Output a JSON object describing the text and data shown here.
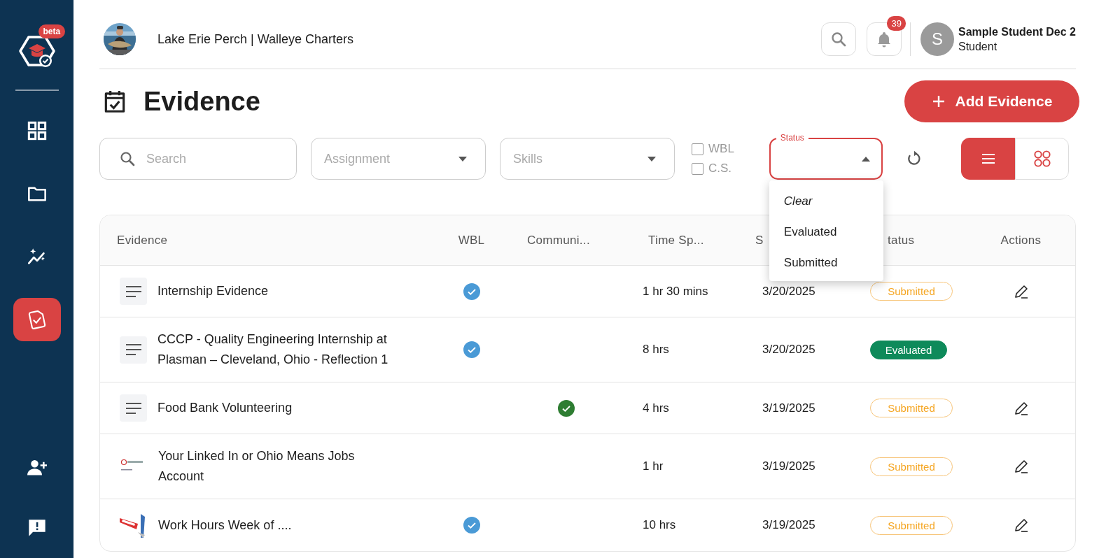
{
  "sidebar": {
    "badge": "beta",
    "items": [
      {
        "kind": "grid",
        "selected": false
      },
      {
        "kind": "folder",
        "selected": false
      },
      {
        "kind": "chart",
        "selected": false
      },
      {
        "kind": "evidence",
        "selected": true
      }
    ],
    "bottom_items": [
      {
        "kind": "add-user",
        "selected": false
      },
      {
        "kind": "feedback",
        "selected": false
      }
    ]
  },
  "header": {
    "organization": "Lake Erie Perch | Walleye Charters",
    "notifications": "39",
    "user": {
      "initial": "S",
      "name": "Sample Student Dec 2",
      "role": "Student"
    }
  },
  "page": {
    "title": "Evidence",
    "add_button": "Add Evidence"
  },
  "filters": {
    "search": {
      "placeholder": "Search"
    },
    "assignment": {
      "placeholder": "Assignment"
    },
    "skills": {
      "placeholder": "Skills"
    },
    "checkboxes": [
      {
        "label": "WBL",
        "checked": false
      },
      {
        "label": "C.S.",
        "checked": false
      }
    ],
    "status": {
      "label": "Status",
      "expanded": true,
      "options": [
        {
          "label": "Clear",
          "kind": "clear"
        },
        {
          "label": "Evaluated",
          "kind": "option"
        },
        {
          "label": "Submitted",
          "kind": "option"
        }
      ]
    },
    "views": [
      {
        "kind": "list",
        "selected": true
      },
      {
        "kind": "grid",
        "selected": false
      }
    ]
  },
  "table": {
    "columns": [
      "Evidence",
      "WBL",
      "Communi...",
      "Time Sp...",
      "S",
      "tatus",
      "Actions"
    ],
    "rows": [
      {
        "kind": "document",
        "title": "Internship Evidence",
        "wbl": true,
        "community": false,
        "time": "1 hr 30 mins",
        "date": "3/20/2025",
        "status": {
          "label": "Submitted",
          "kind": "submitted"
        },
        "editable": true
      },
      {
        "kind": "document",
        "title": "CCCP - Quality Engineering Internship at Plasman – Cleveland, Ohio - Reflection 1",
        "wbl": true,
        "community": false,
        "time": "8 hrs",
        "date": "3/20/2025",
        "status": {
          "label": "Evaluated",
          "kind": "evaluated"
        },
        "editable": false
      },
      {
        "kind": "document",
        "title": "Food Bank Volunteering",
        "wbl": false,
        "community": true,
        "time": "4 hrs",
        "date": "3/19/2025",
        "status": {
          "label": "Submitted",
          "kind": "submitted"
        },
        "editable": true
      },
      {
        "kind": "picture",
        "title": "Your Linked In or Ohio Means Jobs Account",
        "wbl": false,
        "community": false,
        "time": "1 hr",
        "date": "3/19/2025",
        "status": {
          "label": "Submitted",
          "kind": "submitted"
        },
        "editable": true
      },
      {
        "kind": "picture",
        "title": "Work Hours Week of ....",
        "wbl": true,
        "community": false,
        "time": "10 hrs",
        "date": "3/19/2025",
        "status": {
          "label": "Submitted",
          "kind": "submitted"
        },
        "editable": true
      }
    ]
  }
}
